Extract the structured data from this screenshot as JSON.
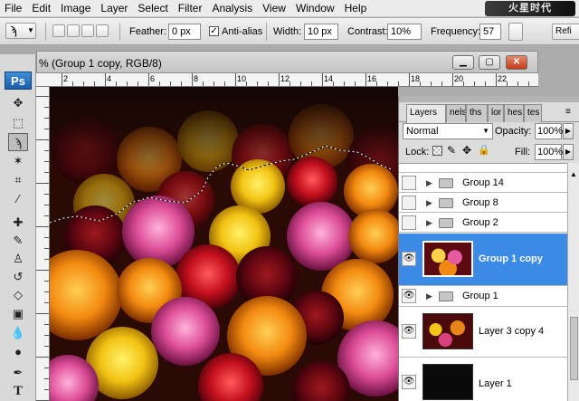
{
  "menu": [
    "File",
    "Edit",
    "Image",
    "Layer",
    "Select",
    "Filter",
    "Analysis",
    "View",
    "Window",
    "Help"
  ],
  "brand_logo": "火星时代",
  "options": {
    "feather_label": "Feather:",
    "feather_value": "0 px",
    "antialias_label": "Anti-alias",
    "antialias_checked": "✓",
    "width_label": "Width:",
    "width_value": "10 px",
    "contrast_label": "Contrast:",
    "contrast_value": "10%",
    "frequency_label": "Frequency:",
    "frequency_value": "57",
    "refine_label": "Refi"
  },
  "toolbox": {
    "ps_badge": "Ps"
  },
  "document": {
    "title": "% (Group 1 copy, RGB/8)",
    "ruler_numbers": [
      "2",
      "4",
      "6",
      "8",
      "10",
      "12",
      "14",
      "16",
      "18",
      "20",
      "22"
    ]
  },
  "layers_panel": {
    "tabs": [
      "Layers ×",
      "nels",
      "ths",
      "lor",
      "hes",
      "tes"
    ],
    "blend_mode": "Normal",
    "opacity_label": "Opacity:",
    "opacity_value": "100%",
    "lock_label": "Lock:",
    "fill_label": "Fill:",
    "fill_value": "100%",
    "layers": [
      {
        "name": "Group 14",
        "kind": "group",
        "visible": false
      },
      {
        "name": "Group 8",
        "kind": "group",
        "visible": false
      },
      {
        "name": "Group 2",
        "kind": "group",
        "visible": false
      },
      {
        "name": "Group 1 copy",
        "kind": "layer",
        "visible": true,
        "selected": true
      },
      {
        "name": "Group 1",
        "kind": "group",
        "visible": true
      },
      {
        "name": "Layer 3 copy 4",
        "kind": "layer",
        "visible": true
      },
      {
        "name": "Layer 1",
        "kind": "layer",
        "visible": true
      }
    ]
  },
  "colors": {
    "selection_blue": "#3a8ae6",
    "ps_blue": "#1c5ea9"
  }
}
